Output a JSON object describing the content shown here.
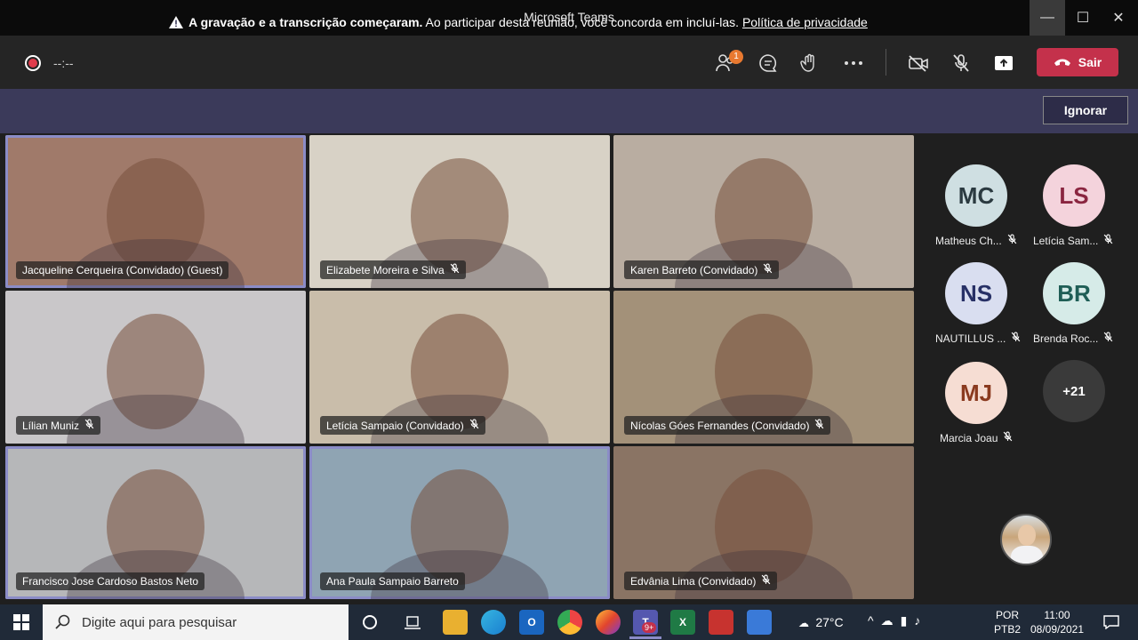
{
  "window": {
    "title": "Microsoft Teams",
    "min": "—",
    "max": "☐",
    "close": "✕"
  },
  "toolbar": {
    "timer": "--:--",
    "participants_badge": "1",
    "leave_label": "Sair"
  },
  "banner": {
    "bold": "A gravação e a transcrição começaram.",
    "text": " Ao participar desta reunião, você concorda em incluí-las. ",
    "link": "Política de privacidade",
    "dismiss": "Ignorar"
  },
  "tiles": [
    {
      "name": "Jacqueline Cerqueira (Convidado) (Guest)",
      "muted": false,
      "active": true,
      "bg": "#a07a6a"
    },
    {
      "name": "Elizabete Moreira e Silva",
      "muted": true,
      "active": false,
      "bg": "#d8d2c6"
    },
    {
      "name": "Karen Barreto (Convidado)",
      "muted": true,
      "active": false,
      "bg": "#b9ada1"
    },
    {
      "name": "Lílian Muniz",
      "muted": true,
      "active": false,
      "bg": "#c9c7c9"
    },
    {
      "name": "Letícia Sampaio (Convidado)",
      "muted": true,
      "active": false,
      "bg": "#c9bdaa"
    },
    {
      "name": "Nícolas Góes Fernandes (Convidado)",
      "muted": true,
      "active": false,
      "bg": "#a39179"
    },
    {
      "name": "Francisco Jose Cardoso Bastos Neto",
      "muted": false,
      "active": true,
      "bg": "#b6b7b9"
    },
    {
      "name": "Ana Paula Sampaio Barreto",
      "muted": false,
      "active": true,
      "bg": "#8fa4b3"
    },
    {
      "name": "Edvânia Lima (Convidado)",
      "muted": true,
      "active": false,
      "bg": "#8a7464"
    }
  ],
  "side": {
    "people": [
      {
        "initials": "MC",
        "name": "Matheus Ch...",
        "color": "#cfdfe2",
        "text": "#2b3a40"
      },
      {
        "initials": "LS",
        "name": "Letícia Sam...",
        "color": "#f4d3dc",
        "text": "#8a2540"
      },
      {
        "initials": "NS",
        "name": "NAUTILLUS ...",
        "color": "#d9def0",
        "text": "#273066"
      },
      {
        "initials": "BR",
        "name": "Brenda Roc...",
        "color": "#d6ebe8",
        "text": "#1f5e56"
      },
      {
        "initials": "MJ",
        "name": "Marcia Joau",
        "color": "#f6ddd3",
        "text": "#8a3a1f"
      }
    ],
    "overflow": "+21"
  },
  "taskbar": {
    "search_placeholder": "Digite aqui para pesquisar",
    "weather": "27°C",
    "lang_top": "POR",
    "lang_bottom": "PTB2",
    "time": "11:00",
    "date": "08/09/2021",
    "teams_badge": "9+"
  },
  "colors": {
    "accent": "#8b8cc7",
    "leave": "#c4314b",
    "banner": "#3b3a5a"
  }
}
